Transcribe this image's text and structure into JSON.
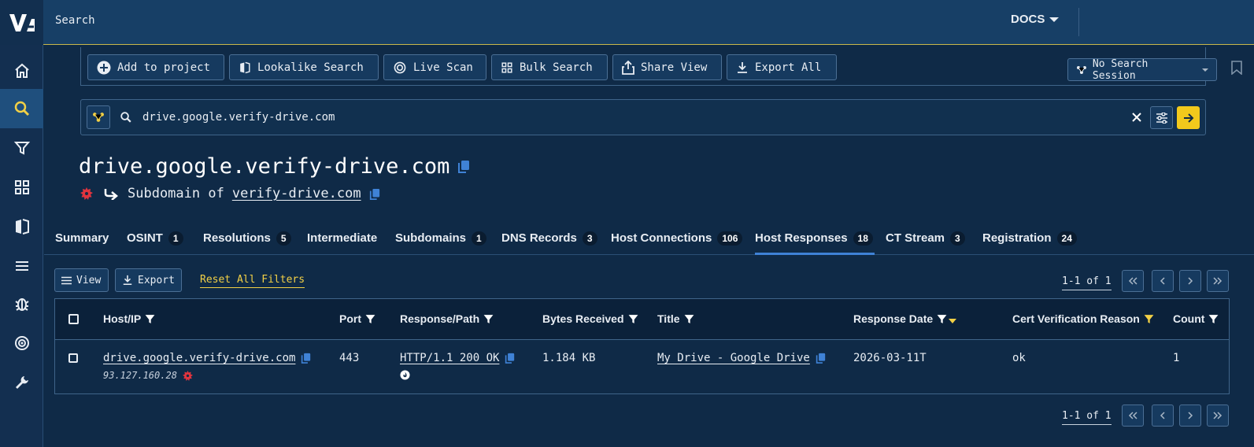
{
  "topbar": {
    "title": "Search",
    "docs_label": "DOCS"
  },
  "toolbar": {
    "add_to_project": "Add to project",
    "lookalike_search": "Lookalike Search",
    "live_scan": "Live Scan",
    "bulk_search": "Bulk Search",
    "share_view": "Share View",
    "export_all": "Export All",
    "session": "No Search Session"
  },
  "search": {
    "query": "drive.google.verify-drive.com"
  },
  "header": {
    "domain": "drive.google.verify-drive.com",
    "subdomain_prefix": "Subdomain of",
    "parent_domain": "verify-drive.com"
  },
  "tabs": [
    {
      "label": "Summary",
      "count": ""
    },
    {
      "label": "OSINT",
      "count": "1"
    },
    {
      "label": "Resolutions",
      "count": "5"
    },
    {
      "label": "Intermediate",
      "count": ""
    },
    {
      "label": "Subdomains",
      "count": "1"
    },
    {
      "label": "DNS Records",
      "count": "3"
    },
    {
      "label": "Host Connections",
      "count": "106"
    },
    {
      "label": "Host Responses",
      "count": "18"
    },
    {
      "label": "CT Stream",
      "count": "3"
    },
    {
      "label": "Registration",
      "count": "24"
    }
  ],
  "table_toolbar": {
    "view": "View",
    "export": "Export",
    "reset": "Reset All Filters",
    "pager": "1-1 of 1"
  },
  "columns": [
    "Host/IP",
    "Port",
    "Response/Path",
    "Bytes Received",
    "Title",
    "Response Date",
    "Cert Verification Reason",
    "Count"
  ],
  "rows": [
    {
      "host": "drive.google.verify-drive.com",
      "ip": "93.127.160.28",
      "port": "443",
      "response": "HTTP/1.1 200 OK",
      "bytes": "1.184 KB",
      "title": "My Drive - Google Drive",
      "date": "2026-03-11T",
      "cert_reason": "ok",
      "count": "1"
    }
  ],
  "colors": {
    "accent_yellow": "#f2d046",
    "link_blue": "#3f82d6",
    "danger_red": "#e0343e"
  }
}
